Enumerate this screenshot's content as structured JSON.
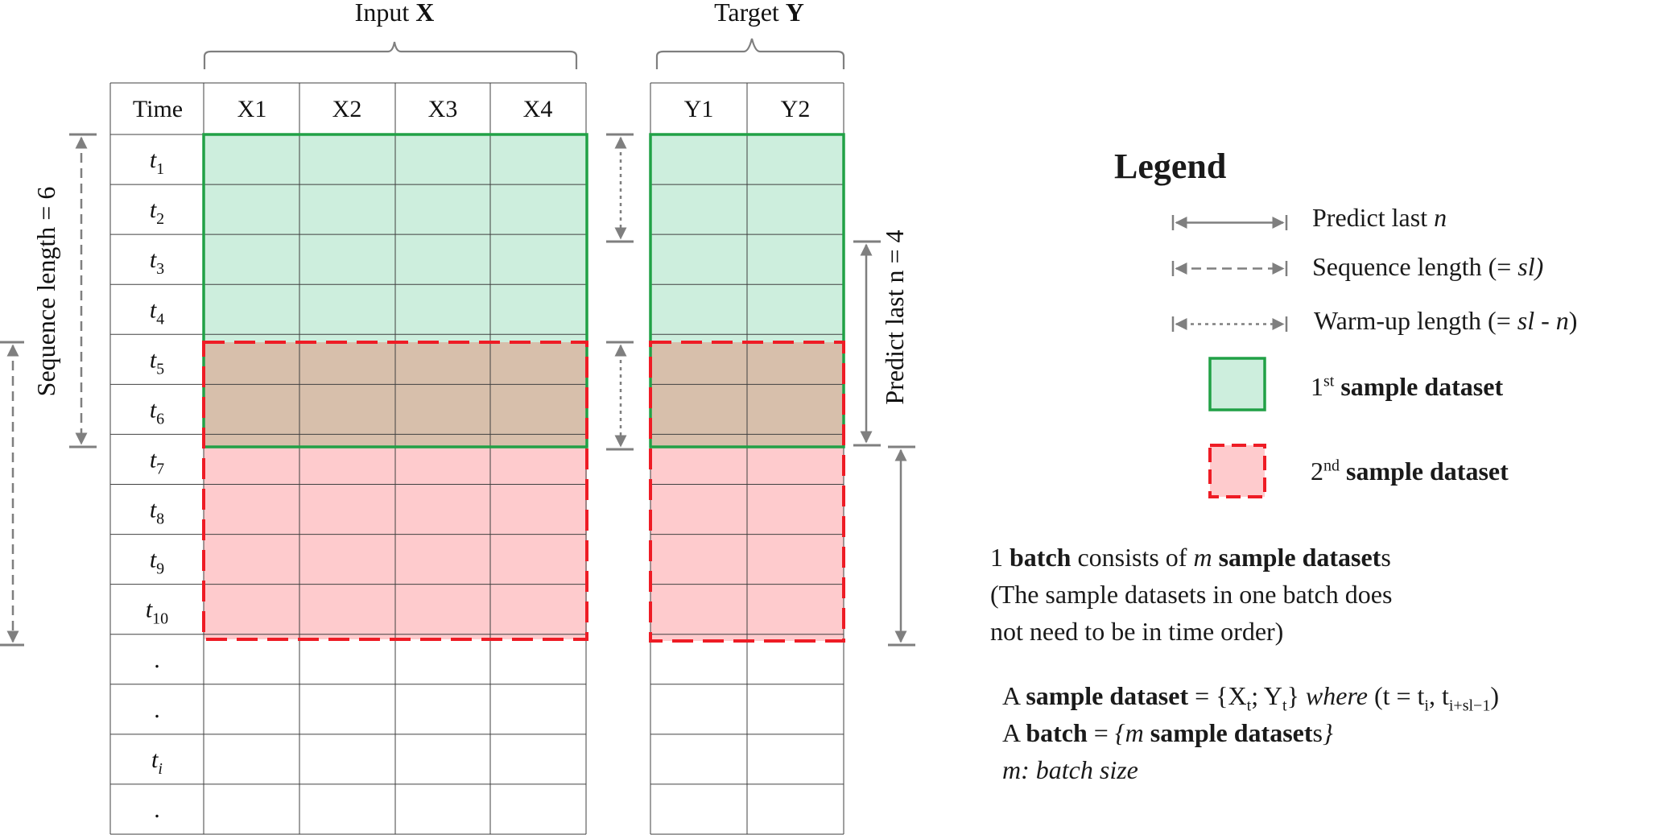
{
  "input_group": {
    "label": "Input",
    "bold": "X"
  },
  "target_group": {
    "label": "Target",
    "bold": "Y"
  },
  "table_x": {
    "headers": [
      "Time",
      "X1",
      "X2",
      "X3",
      "X4"
    ],
    "time_labels": [
      {
        "base": "t",
        "sub": "1"
      },
      {
        "base": "t",
        "sub": "2"
      },
      {
        "base": "t",
        "sub": "3"
      },
      {
        "base": "t",
        "sub": "4"
      },
      {
        "base": "t",
        "sub": "5"
      },
      {
        "base": "t",
        "sub": "6"
      },
      {
        "base": "t",
        "sub": "7"
      },
      {
        "base": "t",
        "sub": "8"
      },
      {
        "base": "t",
        "sub": "9"
      },
      {
        "base": "t",
        "sub": "10"
      },
      {
        "base": ".",
        "sub": ""
      },
      {
        "base": ".",
        "sub": ""
      },
      {
        "base": "t",
        "sub": "i"
      },
      {
        "base": ".",
        "sub": ""
      }
    ]
  },
  "table_y": {
    "headers": [
      "Y1",
      "Y2"
    ]
  },
  "annotations": {
    "sequence_length": "Sequence length = 6",
    "predict_last": "Predict last n = 4"
  },
  "colors": {
    "first_sample_fill": "#cdeedd",
    "second_sample_fill": "#fecbcd",
    "overlap_fill": "#d7bfab",
    "green_border": "#21a146",
    "red_border": "#ee1c25",
    "arrow_gray": "#7f7f7f",
    "grid": "#404040"
  },
  "legend": {
    "title": "Legend",
    "predict_last": {
      "text": "Predict last ",
      "italic": "n"
    },
    "sequence_length": {
      "text": "Sequence length (= ",
      "italic": "sl)"
    },
    "warmup_length": {
      "text": "Warm-up length (= ",
      "italic": "sl - n",
      "close": ")"
    },
    "first_sample": {
      "num": "1",
      "sup": "st",
      "bold": " sample dataset"
    },
    "second_sample": {
      "num": "2",
      "sup": "nd",
      "bold": " sample dataset"
    }
  },
  "batch_note": {
    "line1": {
      "a": "1 ",
      "b": "batch",
      "c": " consists of ",
      "d": "m",
      "e": " ",
      "f": "sample dataset",
      "g": "s"
    },
    "line2": "(The sample datasets in one batch does",
    "line3": "not need to be in time order)"
  },
  "definitions": {
    "sample": {
      "a": "A ",
      "b": "sample dataset",
      "c": " = {X",
      "d": "t",
      "e": "; Y",
      "f": "t",
      "g": "} ",
      "h": "where",
      "i": " (t = t",
      "j": "i",
      "k": ", t",
      "l": "i+sl−1",
      "m": ")"
    },
    "batch": {
      "a": "A ",
      "b": "batch",
      "c": " = ",
      "d": "{m",
      "e": " sample dataset",
      "f": "s",
      "g": "}"
    },
    "batch_size": "m: batch size"
  }
}
